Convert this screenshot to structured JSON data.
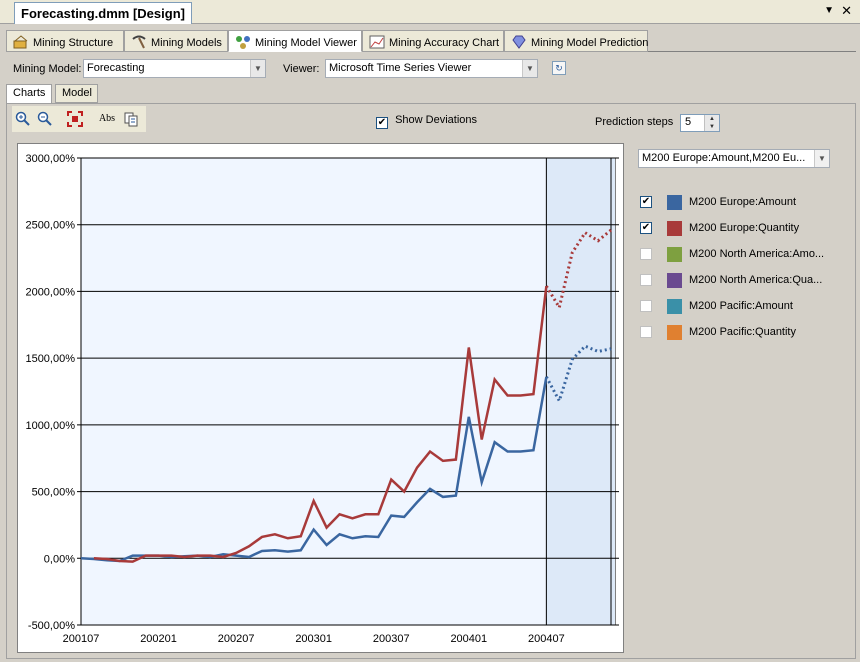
{
  "document_tab": {
    "title": "Forecasting.dmm [Design]"
  },
  "designer_tabs": [
    {
      "label": "Mining Structure",
      "icon": "structure-icon"
    },
    {
      "label": "Mining Models",
      "icon": "pickaxe-icon"
    },
    {
      "label": "Mining Model Viewer",
      "icon": "viewer-icon"
    },
    {
      "label": "Mining Accuracy Chart",
      "icon": "accuracy-chart-icon"
    },
    {
      "label": "Mining Model Prediction",
      "icon": "diamond-icon"
    }
  ],
  "toolbar": {
    "mining_model_label": "Mining Model:",
    "mining_model_value": "Forecasting",
    "viewer_label": "Viewer:",
    "viewer_value": "Microsoft Time Series Viewer"
  },
  "sub_tabs": [
    "Charts",
    "Model"
  ],
  "chart_toolbar": {
    "show_deviations_label": "Show Deviations",
    "show_deviations_checked": true,
    "prediction_steps_label": "Prediction steps",
    "prediction_steps_value": "5",
    "abs_label": "Abs"
  },
  "series_selector": {
    "value": "M200 Europe:Amount,M200 Eu..."
  },
  "legend": [
    {
      "label": "M200 Europe:Amount",
      "checked": true,
      "color": "#3a66a0"
    },
    {
      "label": "M200 Europe:Quantity",
      "checked": true,
      "color": "#a83a3a"
    },
    {
      "label": "M200 North America:Amo...",
      "checked": false,
      "color": "#7ea040"
    },
    {
      "label": "M200 North America:Qua...",
      "checked": false,
      "color": "#6a4a90"
    },
    {
      "label": "M200 Pacific:Amount",
      "checked": false,
      "color": "#3a90a8"
    },
    {
      "label": "M200 Pacific:Quantity",
      "checked": false,
      "color": "#e08030"
    }
  ],
  "chart_data": {
    "type": "line",
    "ylim": [
      -500,
      3000
    ],
    "y_ticks": [
      "-500,00%",
      "0,00%",
      "500,00%",
      "1000,00%",
      "1500,00%",
      "2000,00%",
      "2500,00%",
      "3000,00%"
    ],
    "y_tick_values": [
      -500,
      0,
      500,
      1000,
      1500,
      2000,
      2500,
      3000
    ],
    "x_ticks": [
      "200107",
      "200201",
      "200207",
      "200301",
      "200307",
      "200401",
      "200407"
    ],
    "x_tick_index": [
      0,
      6,
      12,
      18,
      24,
      30,
      36
    ],
    "history_end_index": 36,
    "series": [
      {
        "name": "M200 Europe:Amount",
        "color": "#3a66a0",
        "values": [
          0,
          -5,
          -15,
          -20,
          20,
          20,
          20,
          10,
          15,
          20,
          10,
          30,
          20,
          10,
          55,
          60,
          50,
          60,
          215,
          100,
          180,
          150,
          165,
          160,
          320,
          310,
          420,
          520,
          460,
          470,
          1060,
          570,
          870,
          800,
          800,
          810,
          1360
        ],
        "forecast": [
          1360,
          1180,
          1490,
          1590,
          1550,
          1570
        ]
      },
      {
        "name": "M200 Europe:Quantity",
        "color": "#a83a3a",
        "values": [
          0,
          -5,
          -20,
          -25,
          20,
          20,
          20,
          10,
          20,
          20,
          10,
          40,
          90,
          160,
          180,
          150,
          165,
          430,
          230,
          330,
          300,
          330,
          330,
          590,
          500,
          680,
          800,
          730,
          740,
          1580,
          890,
          1340,
          1220,
          1220,
          1230,
          2040
        ],
        "forecast": [
          2040,
          1880,
          2290,
          2440,
          2380,
          2460
        ]
      }
    ]
  }
}
